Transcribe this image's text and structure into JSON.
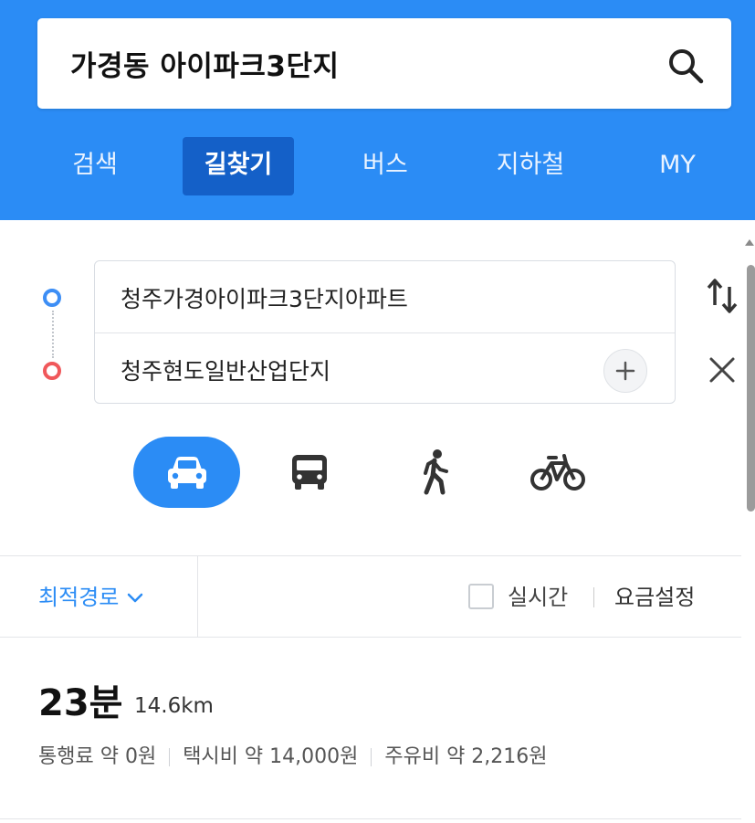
{
  "search": {
    "query": "가경동 아이파크3단지"
  },
  "tabs": [
    {
      "label": "검색",
      "active": false
    },
    {
      "label": "길찾기",
      "active": true
    },
    {
      "label": "버스",
      "active": false
    },
    {
      "label": "지하철",
      "active": false
    },
    {
      "label": "MY",
      "active": false
    }
  ],
  "route": {
    "start": "청주가경아이파크3단지아파트",
    "end": "청주현도일반산업단지"
  },
  "modes": [
    {
      "name": "car",
      "icon": "car-icon",
      "selected": true
    },
    {
      "name": "bus",
      "icon": "bus-icon",
      "selected": false
    },
    {
      "name": "walk",
      "icon": "walk-icon",
      "selected": false
    },
    {
      "name": "bike",
      "icon": "bike-icon",
      "selected": false
    }
  ],
  "options": {
    "route_type": "최적경로",
    "realtime_label": "실시간",
    "realtime_checked": false,
    "fare_setting": "요금설정"
  },
  "result": {
    "duration": "23분",
    "distance": "14.6km",
    "toll": "통행료 약 0원",
    "taxi": "택시비 약 14,000원",
    "fuel": "주유비 약 2,216원"
  },
  "colors": {
    "brand": "#2b8cf5",
    "active_tab": "#1460c8",
    "start_dot": "#3d8ef5",
    "end_dot": "#f0585b"
  }
}
